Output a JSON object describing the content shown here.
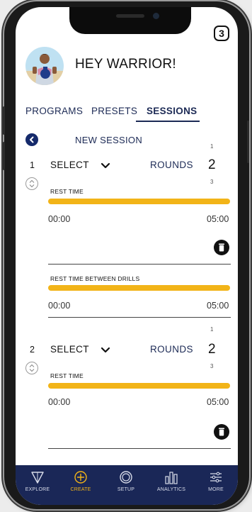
{
  "status": {
    "badge_count": "3"
  },
  "header": {
    "greeting": "HEY WARRIOR!"
  },
  "tabs": [
    {
      "label": "PROGRAMS",
      "active": false
    },
    {
      "label": "PRESETS",
      "active": false
    },
    {
      "label": "SESSIONS",
      "active": true
    }
  ],
  "session_nav": {
    "new_session_label": "NEW SESSION"
  },
  "drills": [
    {
      "number": "1",
      "select_label": "SELECT",
      "rounds_label": "ROUNDS",
      "rounds_prev": "1",
      "rounds_value": "2",
      "rounds_next": "3",
      "rest_label": "REST TIME",
      "rest_fill_fraction": 1.0,
      "rest_start": "00:00",
      "rest_end": "05:00"
    },
    {
      "number": "2",
      "select_label": "SELECT",
      "rounds_label": "ROUNDS",
      "rounds_prev": "1",
      "rounds_value": "2",
      "rounds_next": "3",
      "rest_label": "REST TIME",
      "rest_fill_fraction": 1.0,
      "rest_start": "00:00",
      "rest_end": "05:00"
    }
  ],
  "between_drills": {
    "label": "REST TIME BETWEEN DRILLS",
    "fill_fraction": 1.0,
    "start": "00:00",
    "end": "05:00"
  },
  "bottom_nav": [
    {
      "label": "EXPLORE",
      "icon": "explore-icon",
      "active": false
    },
    {
      "label": "CREATE",
      "icon": "create-icon",
      "active": true
    },
    {
      "label": "SETUP",
      "icon": "setup-icon",
      "active": false
    },
    {
      "label": "ANALYTICS",
      "icon": "analytics-icon",
      "active": false
    },
    {
      "label": "MORE",
      "icon": "more-icon",
      "active": false
    }
  ],
  "colors": {
    "accent": "#f2b418",
    "navy": "#1a2757",
    "tab_text": "#1c2a55"
  }
}
